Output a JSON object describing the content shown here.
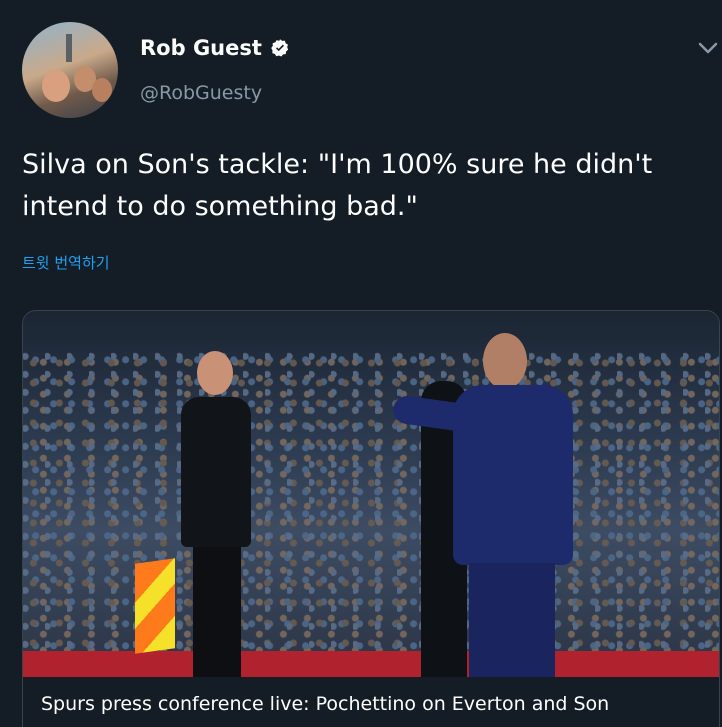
{
  "author": {
    "display_name": "Rob Guest",
    "handle": "@RobGuesty",
    "verified": true
  },
  "tweet": {
    "text": "Silva on Son's tackle: \"I'm 100% sure he didn't intend to do something bad.\"",
    "translate_label": "트윗 번역하기"
  },
  "card": {
    "title": "Spurs press conference live: Pochettino on Everton and Son"
  },
  "colors": {
    "background": "#141d26",
    "link": "#1da1f2",
    "secondary_text": "#8899a6",
    "verified_badge": "#ffffff"
  },
  "icons": {
    "verified": "verified-badge-icon",
    "menu": "chevron-down-icon"
  }
}
